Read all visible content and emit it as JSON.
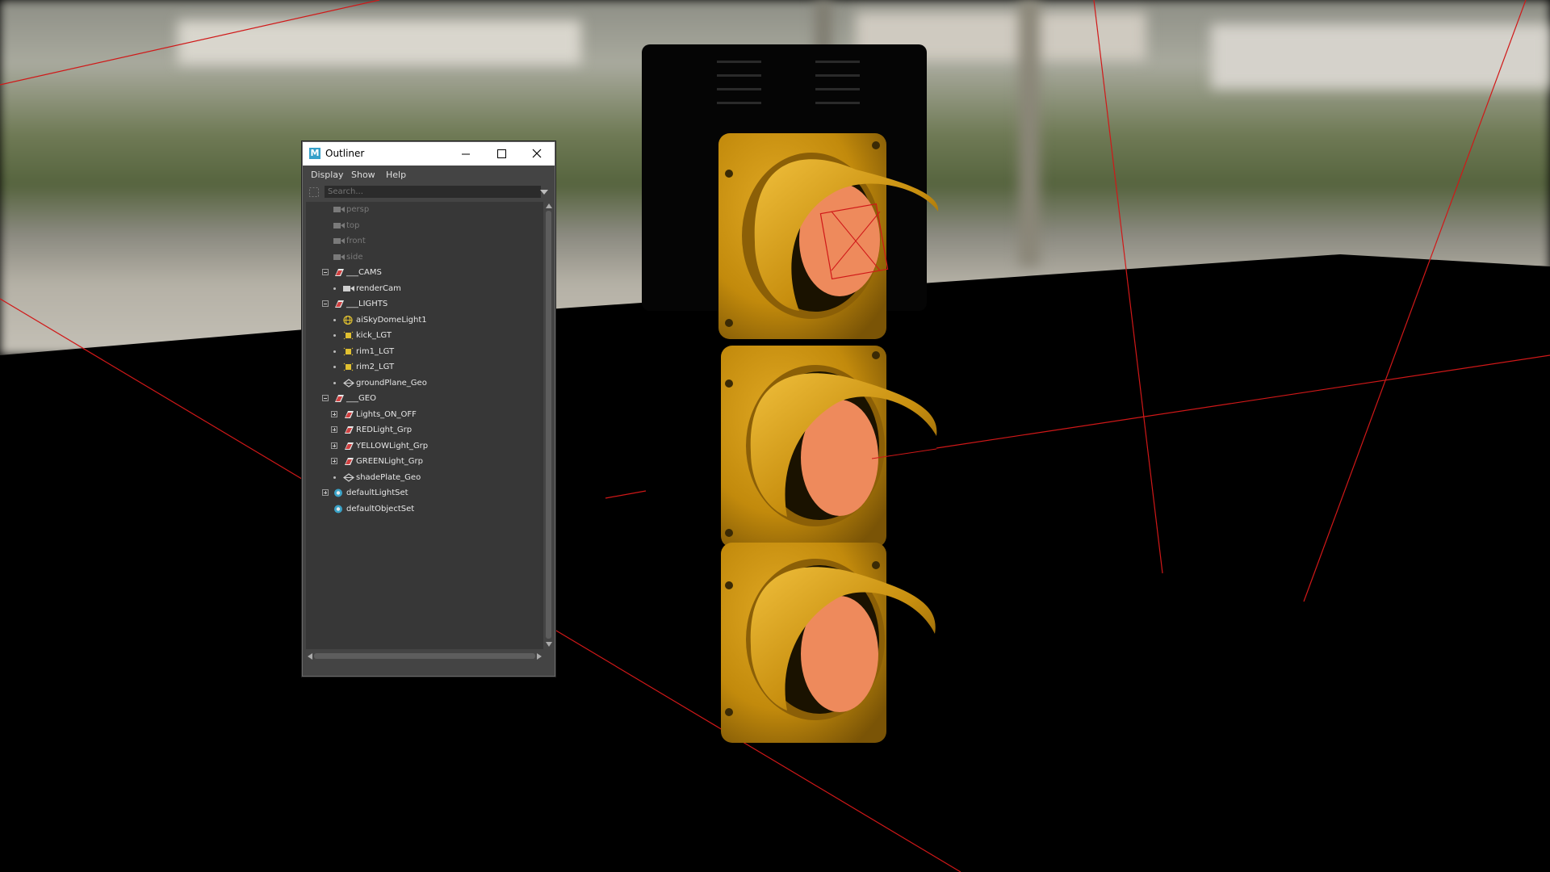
{
  "window": {
    "title": "Outliner",
    "app_icon": "maya-icon",
    "controls": [
      "minimize-icon",
      "maximize-icon",
      "close-icon"
    ]
  },
  "menubar": {
    "items": [
      "Display",
      "Show",
      "Help"
    ]
  },
  "search": {
    "placeholder": "Search..."
  },
  "tree": {
    "nodes": [
      {
        "label": "persp",
        "icon": "camera-icon",
        "dimmed": true
      },
      {
        "label": "top",
        "icon": "camera-icon",
        "dimmed": true
      },
      {
        "label": "front",
        "icon": "camera-icon",
        "dimmed": true
      },
      {
        "label": "side",
        "icon": "camera-icon",
        "dimmed": true
      },
      {
        "label": "___CAMS",
        "icon": "group-icon",
        "expanded": true
      },
      {
        "label": "renderCam",
        "icon": "camera-icon"
      },
      {
        "label": "___LIGHTS",
        "icon": "group-icon",
        "expanded": true
      },
      {
        "label": "aiSkyDomeLight1",
        "icon": "skydome-light-icon"
      },
      {
        "label": "kick_LGT",
        "icon": "area-light-icon"
      },
      {
        "label": "rim1_LGT",
        "icon": "area-light-icon"
      },
      {
        "label": "rim2_LGT",
        "icon": "area-light-icon"
      },
      {
        "label": "groundPlane_Geo",
        "icon": "mesh-icon"
      },
      {
        "label": "___GEO",
        "icon": "group-icon",
        "expanded": true
      },
      {
        "label": "Lights_ON_OFF",
        "icon": "group-icon",
        "collapsed": true
      },
      {
        "label": "REDLight_Grp",
        "icon": "group-icon",
        "collapsed": true
      },
      {
        "label": "YELLOWLight_Grp",
        "icon": "group-icon",
        "collapsed": true
      },
      {
        "label": "GREENLight_Grp",
        "icon": "group-icon",
        "collapsed": true
      },
      {
        "label": "shadePlate_Geo",
        "icon": "mesh-icon"
      },
      {
        "label": "defaultLightSet",
        "icon": "set-icon",
        "collapsed": true
      },
      {
        "label": "defaultObjectSet",
        "icon": "set-icon"
      }
    ]
  },
  "colors": {
    "panel_bg": "#444444",
    "tree_bg": "#373737",
    "traffic_light_yellow": "#c9920d",
    "lens_orange": "#ee8a5c",
    "wire_red": "#d01818"
  }
}
